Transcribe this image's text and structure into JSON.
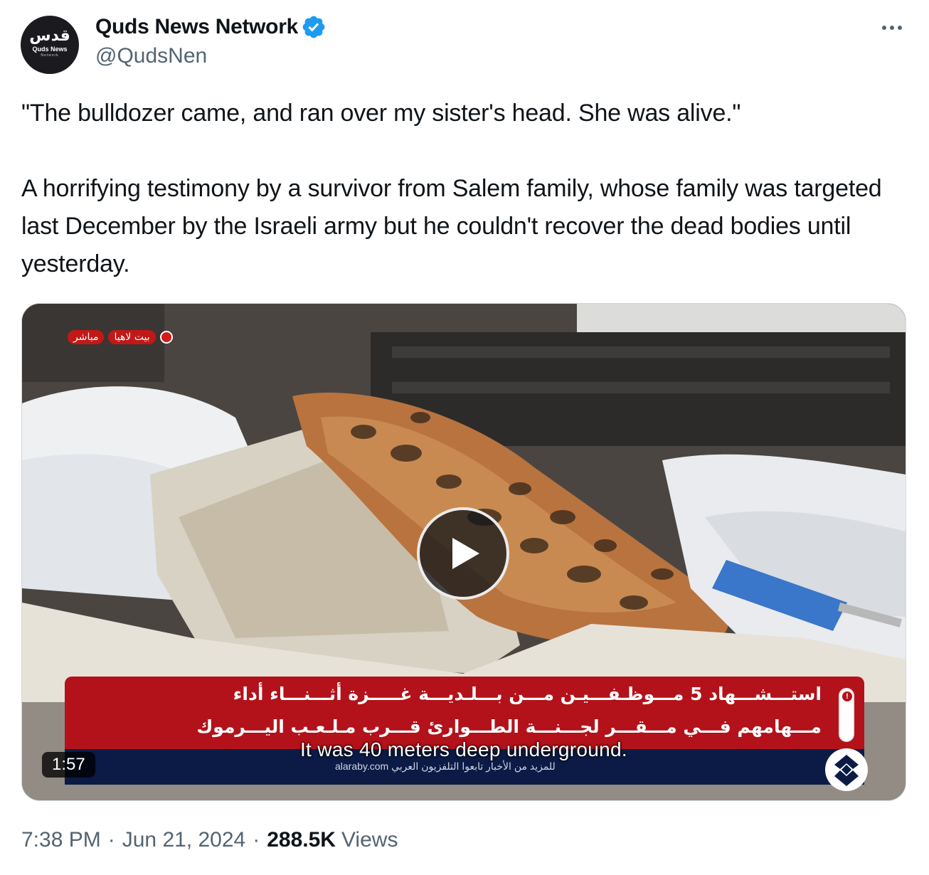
{
  "author": {
    "display_name": "Quds News Network",
    "handle": "@QudsNen",
    "avatar_text_ar": "قدس",
    "avatar_text_en": "Quds News",
    "avatar_text_sub": "Network",
    "verified": true,
    "verified_color": "#1d9bf0"
  },
  "tweet": {
    "quote": "\"The bulldozer came, and ran over my sister's head. She was alive.\"",
    "body": "A horrifying testimony by a survivor from Salem family, whose family was targeted last December by the Israeli army but he couldn't recover the dead bodies until yesterday."
  },
  "video": {
    "location_tag": "بيت لاهيا",
    "live_tag": "مباشر",
    "headline_line1": "استـــشـــهاد 5 مـــوظـفـــيـن مـــن بـــلـديـــة غـــــزة أثـــنـــاء أداء",
    "headline_line2": "مـــهامهم فـــي مـــقـــر لجـــنـــة الطـــوارئ قـــرب مـلـعـب اليـــرموك",
    "subtitle": "It was 40 meters deep underground.",
    "ticker_source": "alaraby.com  للمزيد من الأخبار تابعوا التلفزيون العربي",
    "duration": "1:57",
    "accent_color": "#b3121a"
  },
  "footer": {
    "time": "7:38 PM",
    "date": "Jun 21, 2024",
    "separator": "·",
    "views_count": "288.5K",
    "views_label": "Views"
  }
}
